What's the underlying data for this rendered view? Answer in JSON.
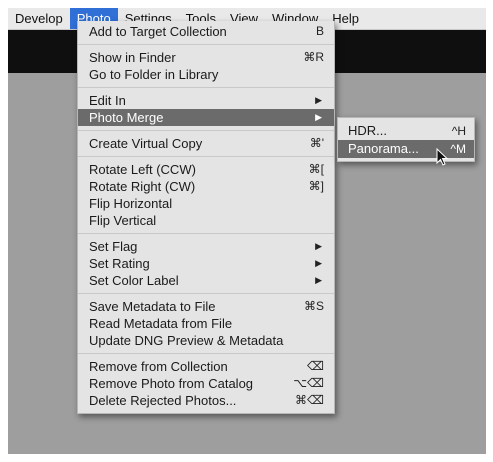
{
  "menubar": {
    "items": [
      "Develop",
      "Photo",
      "Settings",
      "Tools",
      "View",
      "Window",
      "Help"
    ],
    "active": "Photo"
  },
  "photo_menu": {
    "add_to_target": {
      "label": "Add to Target Collection",
      "shortcut": "B"
    },
    "show_in_finder": {
      "label": "Show in Finder",
      "shortcut": "⌘R"
    },
    "go_to_folder": {
      "label": "Go to Folder in Library"
    },
    "edit_in": {
      "label": "Edit In",
      "arrow": "▶"
    },
    "photo_merge": {
      "label": "Photo Merge",
      "arrow": "▶"
    },
    "create_virtual_copy": {
      "label": "Create Virtual Copy",
      "shortcut": "⌘'"
    },
    "rotate_left": {
      "label": "Rotate Left (CCW)",
      "shortcut": "⌘["
    },
    "rotate_right": {
      "label": "Rotate Right (CW)",
      "shortcut": "⌘]"
    },
    "flip_horizontal": {
      "label": "Flip Horizontal"
    },
    "flip_vertical": {
      "label": "Flip Vertical"
    },
    "set_flag": {
      "label": "Set Flag",
      "arrow": "▶"
    },
    "set_rating": {
      "label": "Set Rating",
      "arrow": "▶"
    },
    "set_color_label": {
      "label": "Set Color Label",
      "arrow": "▶"
    },
    "save_metadata": {
      "label": "Save Metadata to File",
      "shortcut": "⌘S"
    },
    "read_metadata": {
      "label": "Read Metadata from File"
    },
    "update_dng": {
      "label": "Update DNG Preview & Metadata"
    },
    "remove_from_collection": {
      "label": "Remove from Collection",
      "shortcut": "⌫"
    },
    "remove_from_catalog": {
      "label": "Remove Photo from Catalog",
      "shortcut": "⌥⌫"
    },
    "delete_rejected": {
      "label": "Delete Rejected Photos...",
      "shortcut": "⌘⌫"
    }
  },
  "merge_submenu": {
    "hdr": {
      "label": "HDR...",
      "shortcut": "^H"
    },
    "panorama": {
      "label": "Panorama...",
      "shortcut": "^M"
    }
  },
  "colors": {
    "menubar_active": "#2f6fd6",
    "highlight": "#6b6b6b",
    "menu_bg": "#e4e4e4",
    "canvas": "#9e9e9e"
  }
}
